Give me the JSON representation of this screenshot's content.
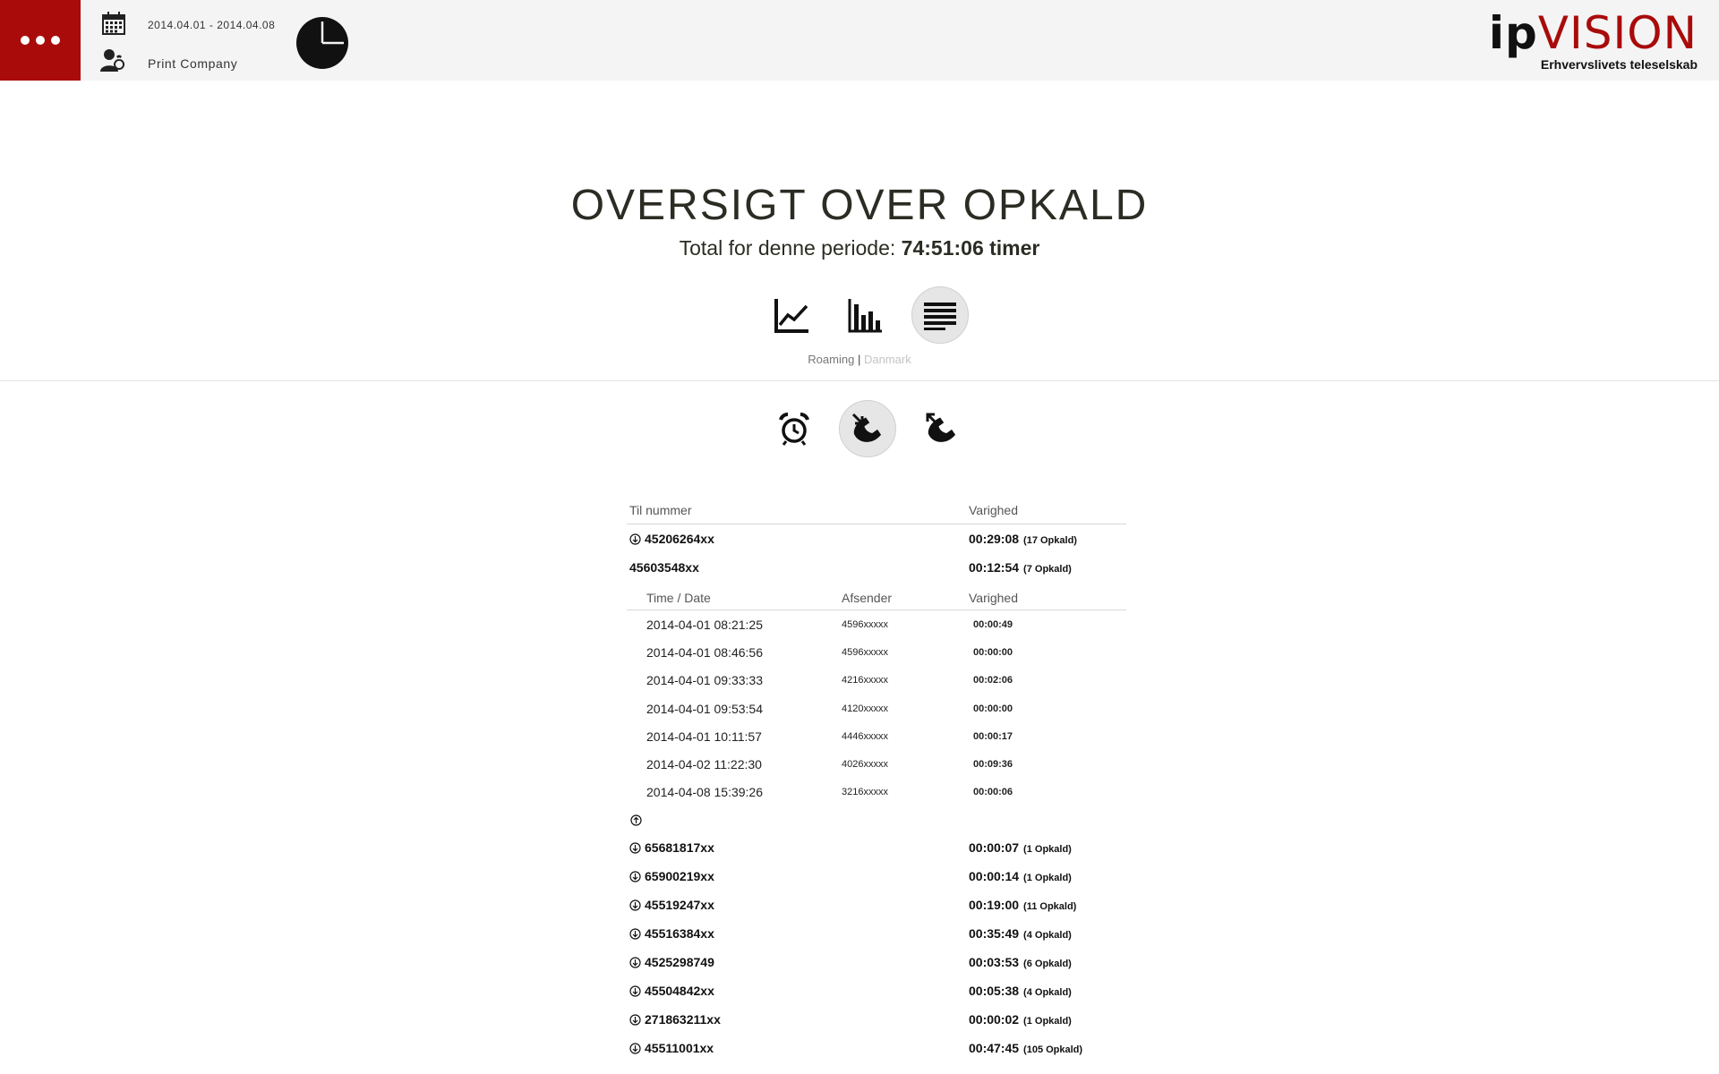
{
  "header": {
    "date_range": "2014.04.01 - 2014.04.08",
    "company": "Print Company",
    "icons": [
      "menu-dots-icon",
      "calendar-icon",
      "user-phone-icon",
      "pie-chart-icon"
    ]
  },
  "logo": {
    "brand_ip": "ip",
    "brand_vision": "VISION",
    "tagline": "Erhvervslivets teleselskab"
  },
  "page": {
    "title": "OVERSIGT OVER OPKALD",
    "total_label": "Total for denne periode:",
    "total_value": "74:51:06 timer"
  },
  "view_toggle": {
    "icons": [
      "line-chart-icon",
      "bar-chart-icon",
      "list-view-icon"
    ],
    "active": "list-view-icon"
  },
  "filter": {
    "roaming": "Roaming",
    "separator": "|",
    "danmark": "Danmark"
  },
  "call_types": {
    "icons": [
      "alarm-clock-icon",
      "incoming-call-icon",
      "outgoing-call-icon"
    ],
    "active": "incoming-call-icon"
  },
  "table": {
    "headers": {
      "number": "Til nummer",
      "duration": "Varighed"
    },
    "rows_top": [
      {
        "number": "45206264xx",
        "duration": "00:29:08",
        "count": "(17 Opkald)"
      }
    ],
    "expanded": {
      "number": "45603548xx",
      "duration": "00:12:54",
      "count": "(7 Opkald)",
      "sub_headers": {
        "time": "Time / Date",
        "sender": "Afsender",
        "duration": "Varighed"
      },
      "details": [
        {
          "time": "2014-04-01 08:21:25",
          "sender": "4596xxxxx",
          "duration": "00:00:49"
        },
        {
          "time": "2014-04-01 08:46:56",
          "sender": "4596xxxxx",
          "duration": "00:00:00"
        },
        {
          "time": "2014-04-01 09:33:33",
          "sender": "4216xxxxx",
          "duration": "00:02:06"
        },
        {
          "time": "2014-04-01 09:53:54",
          "sender": "4120xxxxx",
          "duration": "00:00:00"
        },
        {
          "time": "2014-04-01 10:11:57",
          "sender": "4446xxxxx",
          "duration": "00:00:17"
        },
        {
          "time": "2014-04-02 11:22:30",
          "sender": "4026xxxxx",
          "duration": "00:09:36"
        },
        {
          "time": "2014-04-08 15:39:26",
          "sender": "3216xxxxx",
          "duration": "00:00:06"
        }
      ]
    },
    "rows_bottom": [
      {
        "number": "65681817xx",
        "duration": "00:00:07",
        "count": "(1 Opkald)"
      },
      {
        "number": "65900219xx",
        "duration": "00:00:14",
        "count": "(1 Opkald)"
      },
      {
        "number": "45519247xx",
        "duration": "00:19:00",
        "count": "(11 Opkald)"
      },
      {
        "number": "45516384xx",
        "duration": "00:35:49",
        "count": "(4 Opkald)"
      },
      {
        "number": "4525298749",
        "duration": "00:03:53",
        "count": "(6 Opkald)"
      },
      {
        "number": "45504842xx",
        "duration": "00:05:38",
        "count": "(4 Opkald)"
      },
      {
        "number": "271863211xx",
        "duration": "00:00:02",
        "count": "(1 Opkald)"
      },
      {
        "number": "45511001xx",
        "duration": "00:47:45",
        "count": "(105 Opkald)"
      }
    ]
  }
}
